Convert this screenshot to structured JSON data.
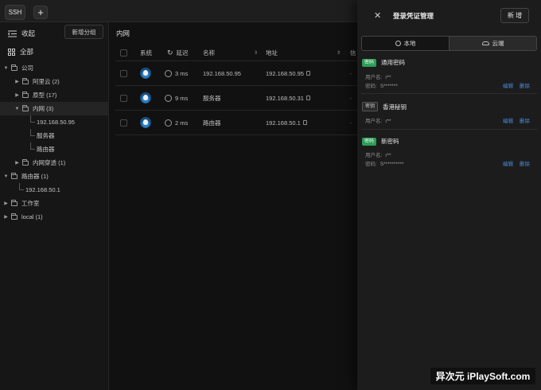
{
  "tabs": {
    "ssh_label": "SSH",
    "add_label": "+"
  },
  "sidebar": {
    "collapse_label": "收起",
    "new_group_label": "新增分组",
    "all_label": "全部",
    "tree": [
      {
        "label": "公司",
        "depth": 0,
        "kind": "folder",
        "expanded": true
      },
      {
        "label": "阿里云 (2)",
        "depth": 1,
        "kind": "folder",
        "expanded": false
      },
      {
        "label": "原型 (17)",
        "depth": 1,
        "kind": "folder",
        "expanded": false
      },
      {
        "label": "内网 (3)",
        "depth": 1,
        "kind": "folder",
        "expanded": true,
        "selected": true
      },
      {
        "label": "192.168.50.95",
        "depth": 2,
        "kind": "leaf"
      },
      {
        "label": "服务器",
        "depth": 2,
        "kind": "leaf"
      },
      {
        "label": "路由器",
        "depth": 2,
        "kind": "leaf"
      },
      {
        "label": "内网穿透 (1)",
        "depth": 1,
        "kind": "folder",
        "expanded": false
      },
      {
        "label": "路由器 (1)",
        "depth": 0,
        "kind": "folder",
        "expanded": true
      },
      {
        "label": "192.168.50.1",
        "depth": 1,
        "kind": "leaf"
      },
      {
        "label": "工作室",
        "depth": 0,
        "kind": "folder",
        "expanded": false
      },
      {
        "label": "local (1)",
        "depth": 0,
        "kind": "folder",
        "expanded": false
      }
    ]
  },
  "main": {
    "breadcrumb": "内网",
    "columns": {
      "os": "系统",
      "latency": "延迟",
      "name": "名称",
      "address": "地址",
      "extra": "信"
    },
    "rows": [
      {
        "latency": "3 ms",
        "name": "192.168.50.95",
        "address": "192.168.50.95"
      },
      {
        "latency": "9 ms",
        "name": "服务器",
        "address": "192.168.50.31"
      },
      {
        "latency": "2 ms",
        "name": "路由器",
        "address": "192.168.50.1"
      }
    ]
  },
  "panel": {
    "title": "登录凭证管理",
    "new_label": "新 增",
    "tab_local": "本地",
    "tab_cloud": "云端",
    "user_label": "用户名:",
    "password_label": "密码:",
    "edit_label": "编辑",
    "delete_label": "删除",
    "credentials": [
      {
        "badge": "密码",
        "type": "password",
        "name": "通用密码",
        "user": "r**",
        "password": "S*******"
      },
      {
        "badge": "密钥",
        "type": "key",
        "name": "香港秘钥",
        "user": "r**"
      },
      {
        "badge": "密码",
        "type": "password",
        "name": "新密码",
        "user": "r**",
        "password": "S**********"
      }
    ]
  },
  "watermark": "异次元 iPlaySoft.com",
  "colors": {
    "accent_green": "#2e9c58",
    "link_blue": "#4a8bd6",
    "panel_bg": "#1c1c1d"
  }
}
